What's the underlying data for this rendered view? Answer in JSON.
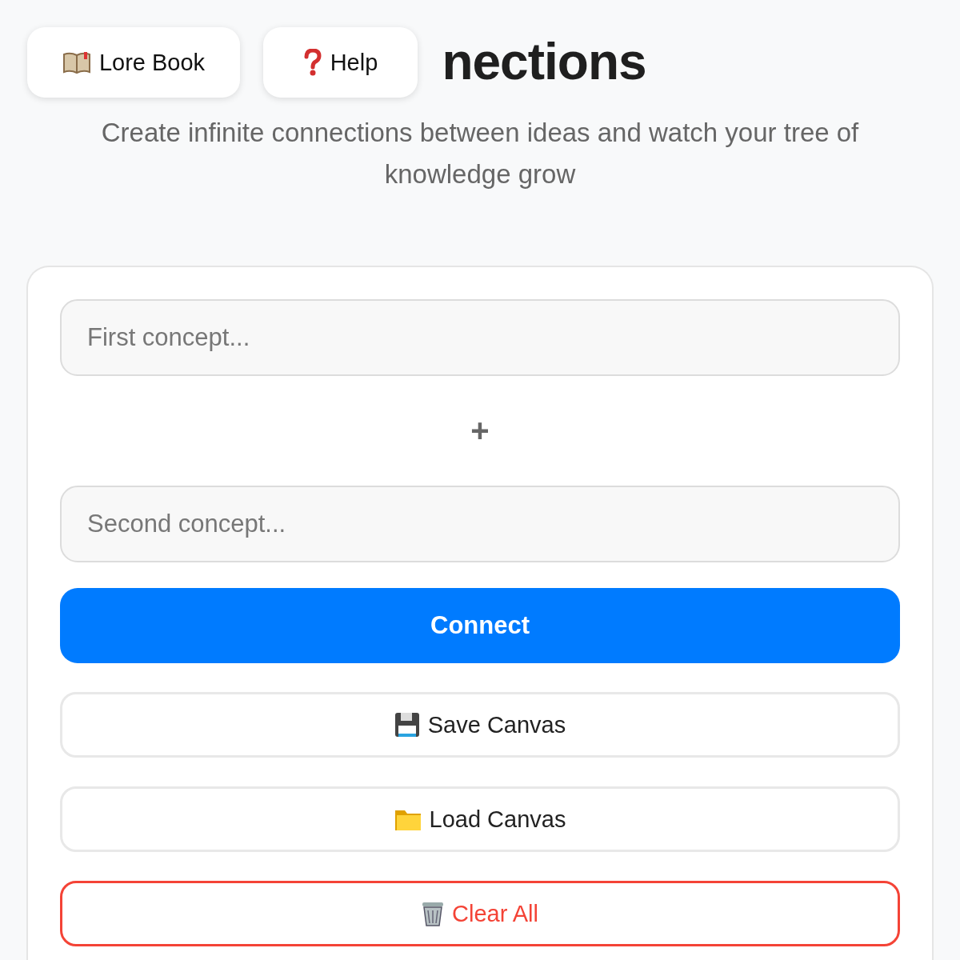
{
  "top_buttons": [
    {
      "label": "Lore Book"
    },
    {
      "label": "Help"
    }
  ],
  "title": "nections",
  "subtitle": "Create infinite connections between ideas and watch your tree of knowledge grow",
  "inputs": [
    {
      "placeholder": "First concept..."
    },
    {
      "placeholder": "Second concept..."
    }
  ],
  "plus": "+",
  "connect_button": "Connect",
  "actions": [
    {
      "label": "Save Canvas",
      "kind": "secondary"
    },
    {
      "label": "Load Canvas",
      "kind": "secondary"
    },
    {
      "label": "Clear All",
      "kind": "danger"
    }
  ]
}
